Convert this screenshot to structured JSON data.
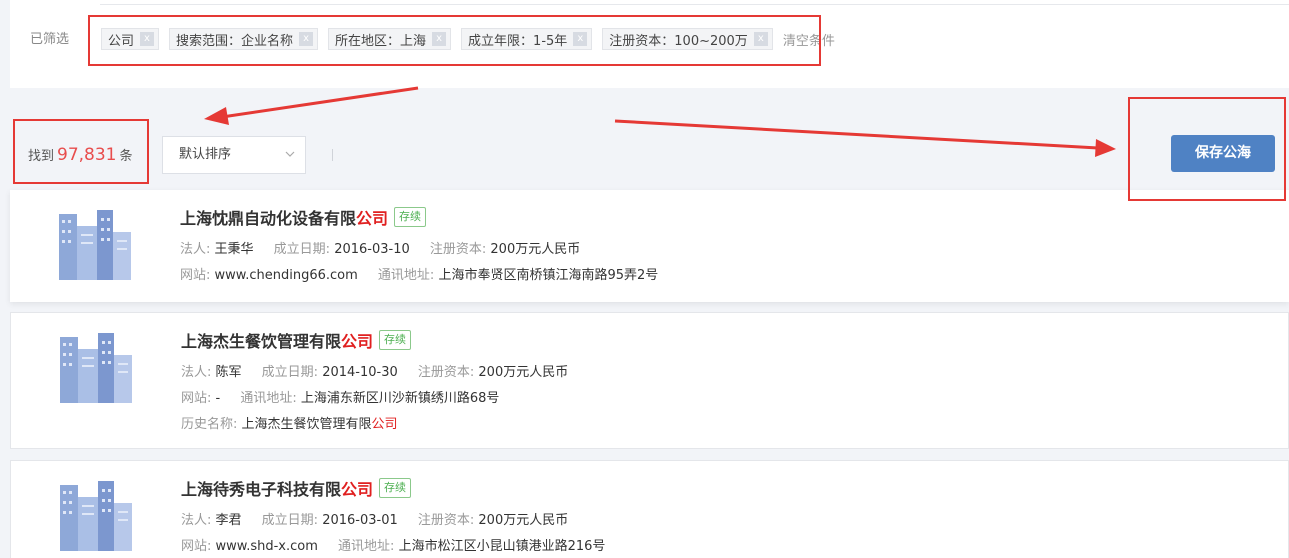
{
  "filter": {
    "label": "已筛选",
    "chips": [
      "公司",
      "搜索范围：企业名称",
      "所在地区：上海",
      "成立年限：1-5年",
      "注册资本：100~200万"
    ],
    "remove_glyph": "x",
    "clear_label": "清空条件"
  },
  "toolbar": {
    "found_prefix": "找到",
    "found_count": "97,831",
    "found_suffix": "条",
    "sort_label": "默认排序",
    "save_label": "保存公海"
  },
  "labels": {
    "legal_rep": "法人: ",
    "founded": "成立日期: ",
    "capital": "注册资本: ",
    "website": "网站: ",
    "address": "通讯地址: ",
    "history_name": "历史名称: "
  },
  "companies": [
    {
      "name": "上海忱鼎自动化设备有限",
      "name_highlight": "公司",
      "status": "存续",
      "legal_rep": "王秉华",
      "founded": "2016-03-10",
      "capital": "200万元人民币",
      "website": "www.chending66.com",
      "address": "上海市奉贤区南桥镇江海南路95弄2号"
    },
    {
      "name": "上海杰生餐饮管理有限",
      "name_highlight": "公司",
      "status": "存续",
      "legal_rep": "陈军",
      "founded": "2014-10-30",
      "capital": "200万元人民币",
      "website": "-",
      "address": "上海浦东新区川沙新镇绣川路68号",
      "history_name": "上海杰生餐饮管理有限",
      "history_highlight": "公司"
    },
    {
      "name": "上海待秀电子科技有限",
      "name_highlight": "公司",
      "status": "存续",
      "legal_rep": "李君",
      "founded": "2016-03-01",
      "capital": "200万元人民币",
      "website": "www.shd-x.com",
      "address": "上海市松江区小昆山镇港业路216号"
    }
  ],
  "colors": {
    "highlight": "#e02020",
    "count": "#e84d4d",
    "save_button": "#4f82c4",
    "annotation": "#e53935",
    "status_tag": "#4caf50"
  }
}
